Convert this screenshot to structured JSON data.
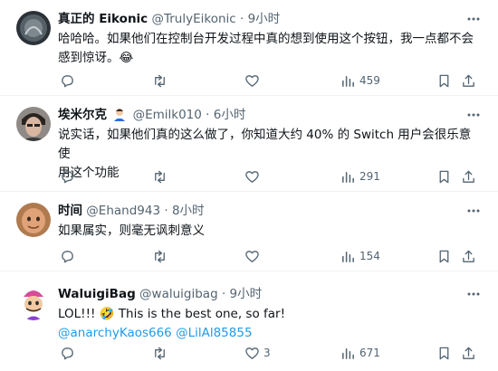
{
  "tweets": [
    {
      "name": "真正的 Eikonic",
      "handle": "@TrulyEikonic",
      "time": "9小时",
      "line1": "哈哈哈。如果他们在控制台开发过程中真的想到使用这个按钮，我一点都不会",
      "line2": "感到惊讶。😂",
      "replies": "",
      "retweets": "",
      "likes": "",
      "views": "459"
    },
    {
      "name": "埃米尔克",
      "handle": "@Emilk010",
      "time": "6小时",
      "line1": "说实话，如果他们真的这么做了，你知道大约 40% 的 Switch 用户会很乐意使",
      "line2": "用这个功能",
      "replies": "",
      "retweets": "",
      "likes": "",
      "views": "291"
    },
    {
      "name": "时间",
      "handle": "@Ehand943",
      "time": "8小时",
      "line1": "如果属实，则毫无讽刺意义",
      "replies": "",
      "retweets": "",
      "likes": "",
      "views": "154"
    },
    {
      "name": "WaluigiBag",
      "handle": "@waluigibag",
      "time": "9小时",
      "line1": "LOL!!! 🤣 This is the best one, so far!",
      "mention1": "@anarchyKaos666",
      "mention2": "@LilAl85855",
      "replies": "",
      "retweets": "",
      "likes": "3",
      "views": "671"
    }
  ],
  "icons": {
    "reply": "reply-icon",
    "retweet": "retweet-icon",
    "like": "heart-icon",
    "views": "views-chart-icon",
    "bookmark": "bookmark-icon",
    "share": "share-icon",
    "more": "more-dots-icon"
  },
  "colors": {
    "text": "#0f1419",
    "meta": "#536471",
    "mention": "#1d9bf0",
    "divider": "#eff3f4"
  }
}
